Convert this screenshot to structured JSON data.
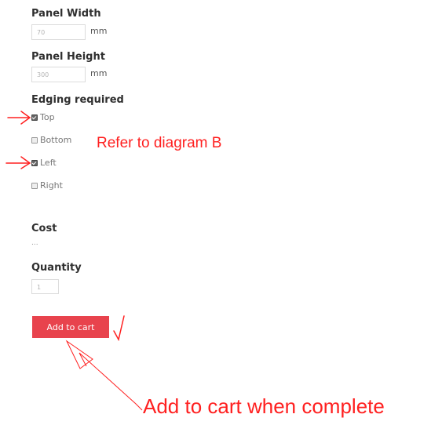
{
  "form": {
    "panel_width": {
      "label": "Panel Width",
      "value": "70",
      "unit": "mm"
    },
    "panel_height": {
      "label": "Panel Height",
      "value": "300",
      "unit": "mm"
    },
    "edging": {
      "label": "Edging required",
      "options": [
        {
          "label": "Top",
          "checked": true
        },
        {
          "label": "Bottom",
          "checked": false
        },
        {
          "label": "Left",
          "checked": true
        },
        {
          "label": "Right",
          "checked": false
        }
      ]
    },
    "cost": {
      "label": "Cost",
      "value": "..."
    },
    "quantity": {
      "label": "Quantity",
      "value": "1"
    },
    "add_to_cart_label": "Add to cart"
  },
  "annotations": {
    "diagram_note": "Refer to diagram B",
    "cart_note": "Add to cart when complete",
    "color": "#ff2020"
  },
  "colors": {
    "button": "#e8434d"
  }
}
